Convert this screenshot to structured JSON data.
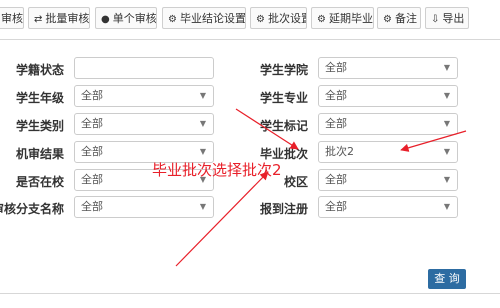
{
  "toolbar": {
    "buttons": [
      {
        "label": "审核",
        "icon": ""
      },
      {
        "label": "批量审核",
        "icon": "⇄"
      },
      {
        "label": "单个审核",
        "icon": "●"
      },
      {
        "label": "毕业结论设置",
        "icon": "⚙"
      },
      {
        "label": "批次设置",
        "icon": "⚙"
      },
      {
        "label": "延期毕业",
        "icon": "⚙"
      },
      {
        "label": "备注",
        "icon": "⚙"
      },
      {
        "label": "导出",
        "icon": "⇩"
      }
    ]
  },
  "form": {
    "left": [
      {
        "label": "学籍状态",
        "value": ""
      },
      {
        "label": "学生年级",
        "value": "全部"
      },
      {
        "label": "学生类别",
        "value": "全部"
      },
      {
        "label": "机审结果",
        "value": "全部"
      },
      {
        "label": "是否在校",
        "value": "全部"
      },
      {
        "label": "审核分支名称",
        "value": "全部"
      }
    ],
    "right": [
      {
        "label": "学生学院",
        "value": "全部"
      },
      {
        "label": "学生专业",
        "value": "全部"
      },
      {
        "label": "学生标记",
        "value": "全部"
      },
      {
        "label": "毕业批次",
        "value": "批次2"
      },
      {
        "label": "校区",
        "value": "全部"
      },
      {
        "label": "报到注册",
        "value": "全部"
      }
    ]
  },
  "query_label": "查 询",
  "annotation": {
    "text": "毕业批次选择批次2",
    "color": "#e8202a"
  }
}
